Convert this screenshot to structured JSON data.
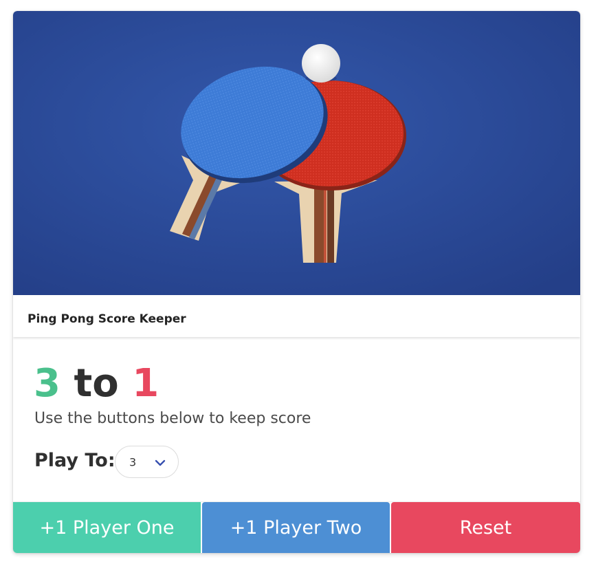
{
  "card": {
    "image_description_icon": "ping-pong-paddles-photo",
    "title": "Ping Pong Score Keeper"
  },
  "score": {
    "player_one": "3",
    "separator": " to ",
    "player_two": "1"
  },
  "subtitle": "Use the buttons below to keep score",
  "play_to": {
    "label": "Play To:",
    "selected_value": "3",
    "icon": "chevron-down-icon"
  },
  "buttons": {
    "player_one": "+1 Player One",
    "player_two": "+1 Player Two",
    "reset": "Reset"
  },
  "colors": {
    "player_one": "#4ac08c",
    "player_two": "#e8485f",
    "player_one_button": "#4ccfad",
    "player_two_button": "#4d8fd4",
    "reset_button": "#e8485f",
    "hero_background": "#2d4d9a"
  }
}
